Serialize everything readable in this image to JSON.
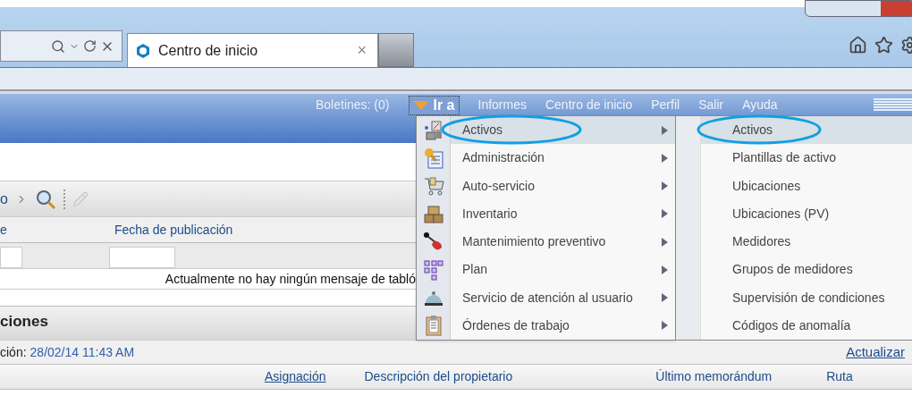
{
  "browser": {
    "tab": {
      "title": "Centro de inicio",
      "close": "×"
    }
  },
  "header": {
    "bulletins": "Boletines: (0)",
    "goto": "Ir a",
    "links": [
      "Informes",
      "Centro de inicio",
      "Perfil",
      "Salir",
      "Ayuda"
    ]
  },
  "toolbar": {
    "breadcrumb": "o"
  },
  "bulletin_table": {
    "columns": [
      "e",
      "Fecha de publicación"
    ],
    "message": "Actualmente no hay ningún mensaje de tabló"
  },
  "section": {
    "title": "ciones",
    "updated_label": "ción:",
    "updated_value": "28/02/14 11:43 AM",
    "refresh": "Actualizar",
    "columns": [
      {
        "label": "Asignación",
        "sortable": true
      },
      {
        "label": "Descripción del propietario",
        "sortable": false
      },
      {
        "label": "Último memorándum",
        "sortable": false
      },
      {
        "label": "Ruta",
        "sortable": false
      }
    ]
  },
  "menu": {
    "items": [
      {
        "label": "Activos",
        "selected": true,
        "highlighted": true
      },
      {
        "label": "Administración",
        "selected": false,
        "highlighted": false
      },
      {
        "label": "Auto-servicio",
        "selected": false,
        "highlighted": false
      },
      {
        "label": "Inventario",
        "selected": false,
        "highlighted": false
      },
      {
        "label": "Mantenimiento preventivo",
        "selected": false,
        "highlighted": false
      },
      {
        "label": "Plan",
        "selected": false,
        "highlighted": false
      },
      {
        "label": "Servicio de atención al usuario",
        "selected": false,
        "highlighted": false
      },
      {
        "label": "Órdenes de trabajo",
        "selected": false,
        "highlighted": false
      }
    ]
  },
  "submenu": {
    "items": [
      {
        "label": "Activos",
        "selected": true,
        "highlighted": true
      },
      {
        "label": "Plantillas de activo",
        "selected": false,
        "highlighted": false
      },
      {
        "label": "Ubicaciones",
        "selected": false,
        "highlighted": false
      },
      {
        "label": "Ubicaciones (PV)",
        "selected": false,
        "highlighted": false
      },
      {
        "label": "Medidores",
        "selected": false,
        "highlighted": false
      },
      {
        "label": "Grupos de medidores",
        "selected": false,
        "highlighted": false
      },
      {
        "label": "Supervisión de condiciones",
        "selected": false,
        "highlighted": false
      },
      {
        "label": "Códigos de anomalía",
        "selected": false,
        "highlighted": false
      }
    ]
  }
}
